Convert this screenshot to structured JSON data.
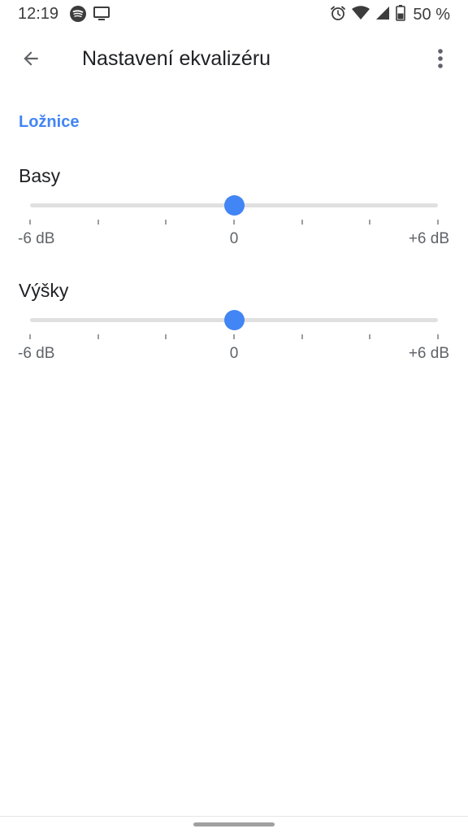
{
  "status_bar": {
    "time": "12:19",
    "battery_text": "50 %",
    "left_icons": [
      "spotify-icon",
      "cast-icon"
    ],
    "right_icons": [
      "alarm-icon",
      "wifi-icon",
      "cell-signal-icon",
      "battery-icon"
    ],
    "battery_level_percent": 50
  },
  "app_bar": {
    "title": "Nastavení ekvalizéru",
    "back_icon": "arrow-back-icon",
    "more_icon": "more-vert-icon"
  },
  "section": {
    "title": "Ložnice"
  },
  "equalizer": {
    "min_db": -6,
    "max_db": 6,
    "tick_count": 7,
    "bands": [
      {
        "label": "Basy",
        "value_db": 0,
        "min_label": "-6 dB",
        "mid_label": "0",
        "max_label": "+6 dB"
      },
      {
        "label": "Výšky",
        "value_db": 0,
        "min_label": "-6 dB",
        "mid_label": "0",
        "max_label": "+6 dB"
      }
    ]
  },
  "colors": {
    "accent": "#4285f4",
    "track": "#e0e0e0",
    "tick": "#9e9e9e",
    "text_primary": "#202124",
    "text_secondary": "#5f6368"
  }
}
